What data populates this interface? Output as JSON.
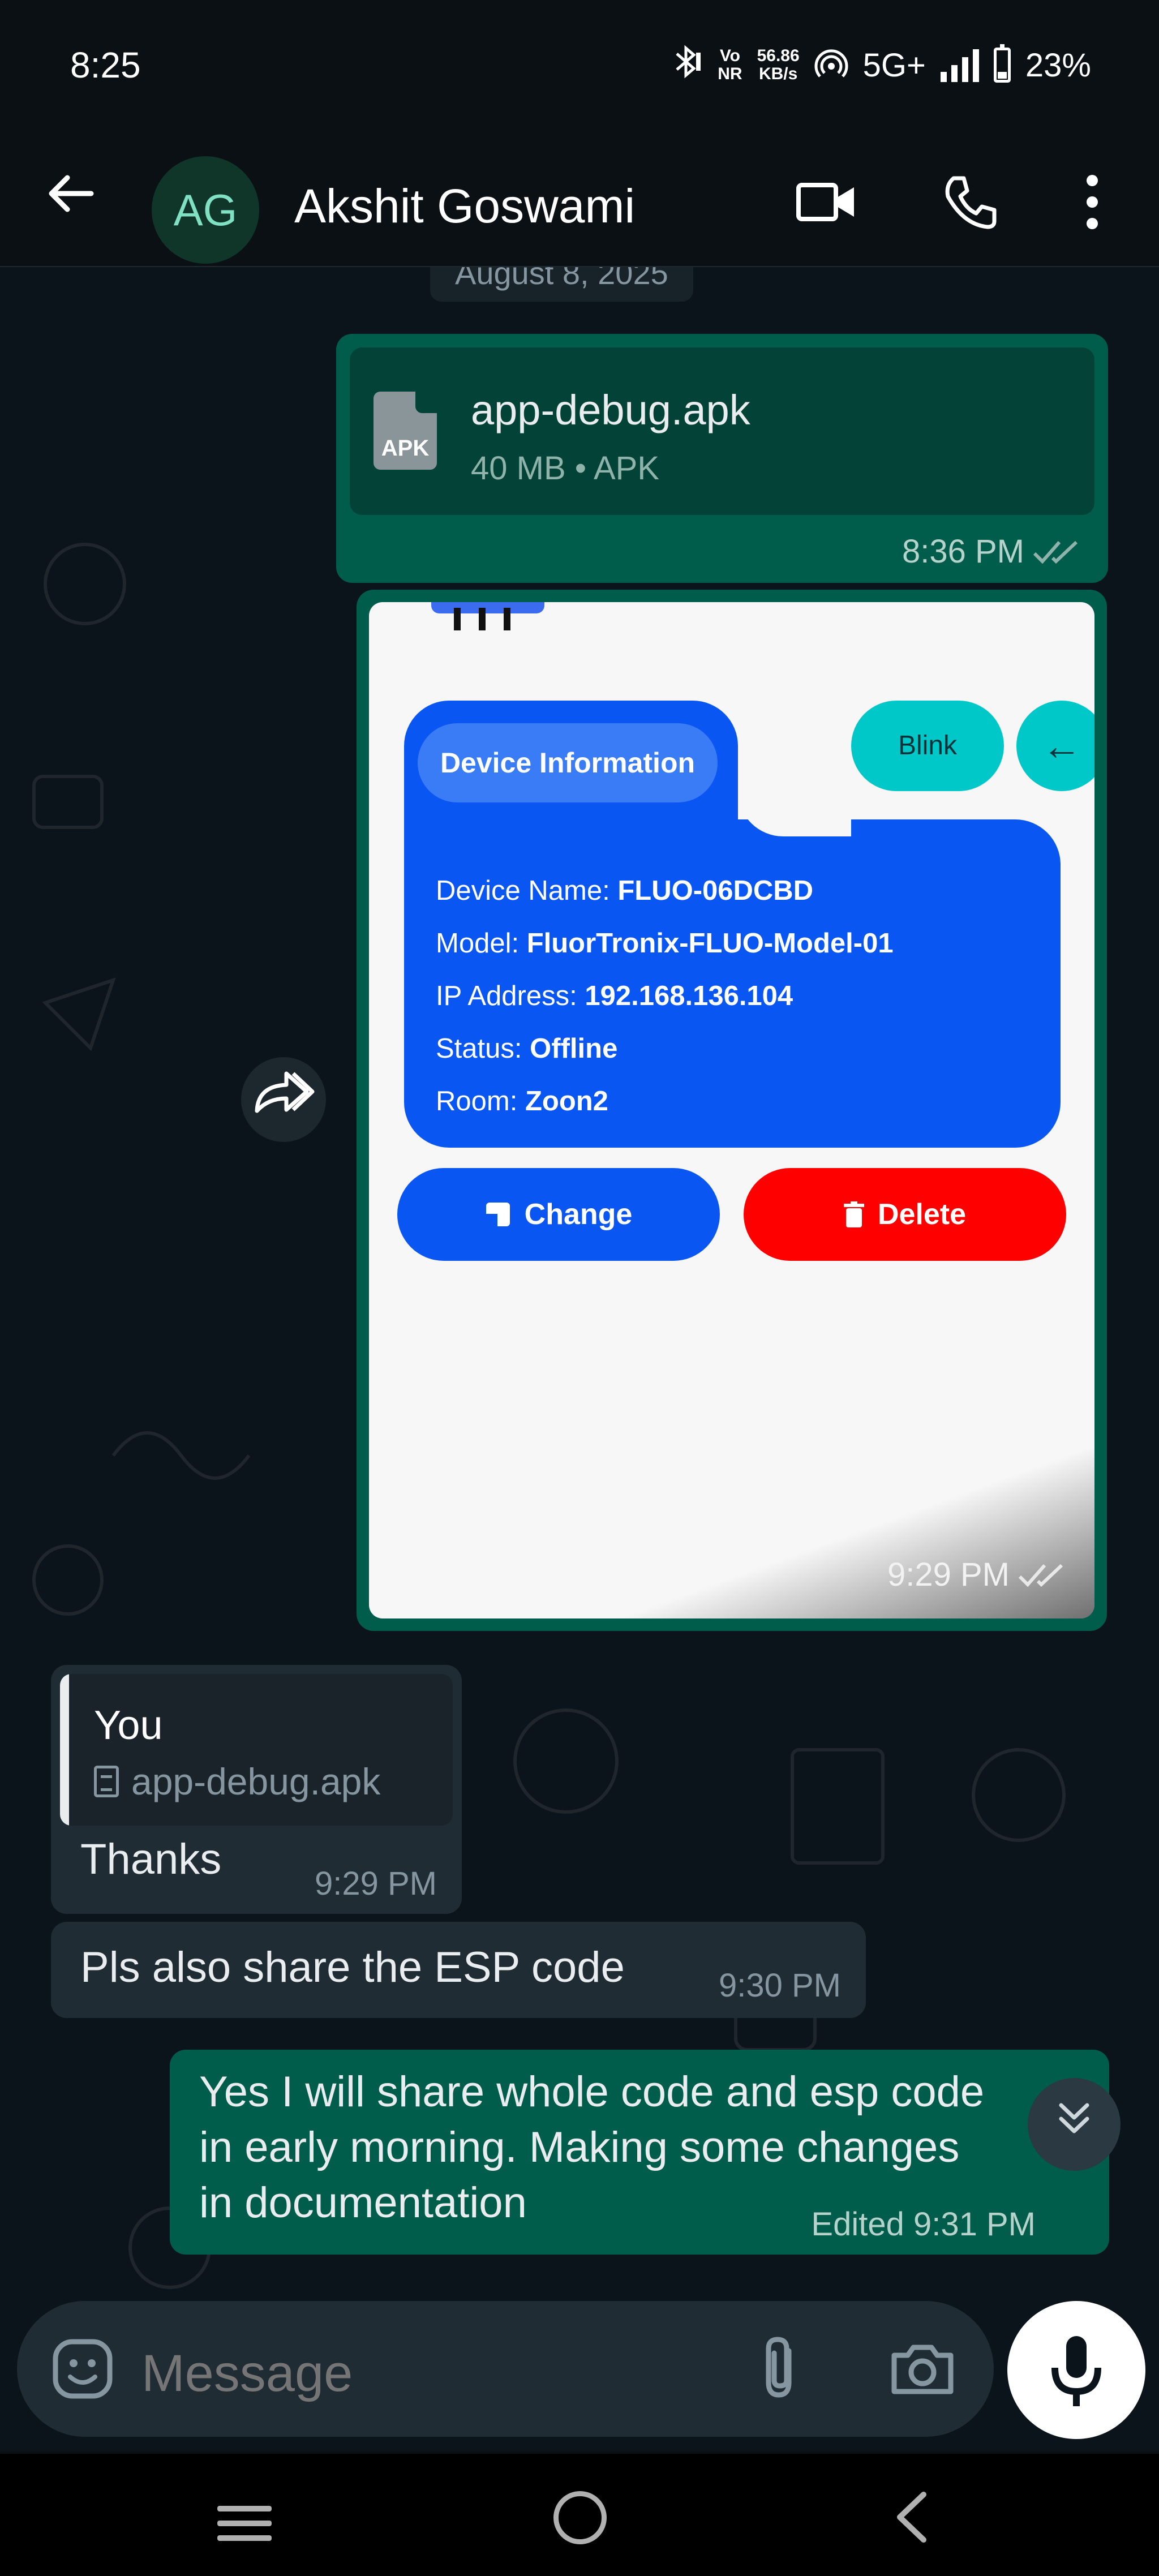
{
  "status_bar": {
    "time": "8:25",
    "net_speed_value": "56.86",
    "net_speed_unit": "KB/s",
    "network": "5G+",
    "vo_label": "Vo",
    "nr_label": "NR",
    "battery": "23%"
  },
  "header": {
    "avatar_initials": "AG",
    "contact_name": "Akshit Goswami"
  },
  "chat": {
    "date_chip": "August 8, 2025",
    "messages": [
      {
        "type": "file",
        "direction": "outgoing",
        "file_name": "app-debug.apk",
        "file_icon_label": "APK",
        "file_info": "40 MB • APK",
        "time": "8:36 PM"
      },
      {
        "type": "image",
        "direction": "outgoing",
        "time": "9:29 PM",
        "screenshot": {
          "tab_label": "Device Information",
          "blink_label": "Blink",
          "back_label": "←",
          "lines": [
            {
              "key": "Device Name:",
              "value": "FLUO-06DCBD"
            },
            {
              "key": "Model:",
              "value": "FluorTronix-FLUO-Model-01"
            },
            {
              "key": "IP Address:",
              "value": "192.168.136.104"
            },
            {
              "key": "Status:",
              "value": "Offline"
            },
            {
              "key": "Room:",
              "value": "Zoon2"
            }
          ],
          "change_label": "Change",
          "delete_label": "Delete"
        }
      },
      {
        "type": "reply",
        "direction": "incoming",
        "quote_author": "You",
        "quote_file": "app-debug.apk",
        "text": "Thanks",
        "time": "9:29 PM"
      },
      {
        "type": "text",
        "direction": "incoming",
        "text": "Pls also share the ESP code",
        "time": "9:30 PM"
      },
      {
        "type": "text",
        "direction": "outgoing",
        "lines": [
          "Yes I will share whole code and esp code",
          "in early morning. Making some changes",
          "in documentation"
        ],
        "time": "Edited 9:31 PM"
      }
    ]
  },
  "input": {
    "placeholder": "Message"
  },
  "colors": {
    "outgoing_bubble": "#005c4b",
    "incoming_bubble": "#202c33",
    "info_card_blue": "#0a56f2",
    "blink_cyan": "#00c8c8",
    "delete_red": "#ff0000"
  },
  "icons": [
    "back-arrow-icon",
    "video-call-icon",
    "phone-icon",
    "more-vert-icon",
    "forward-icon",
    "scroll-down-icon",
    "emoji-icon",
    "attach-icon",
    "camera-icon",
    "mic-icon"
  ]
}
